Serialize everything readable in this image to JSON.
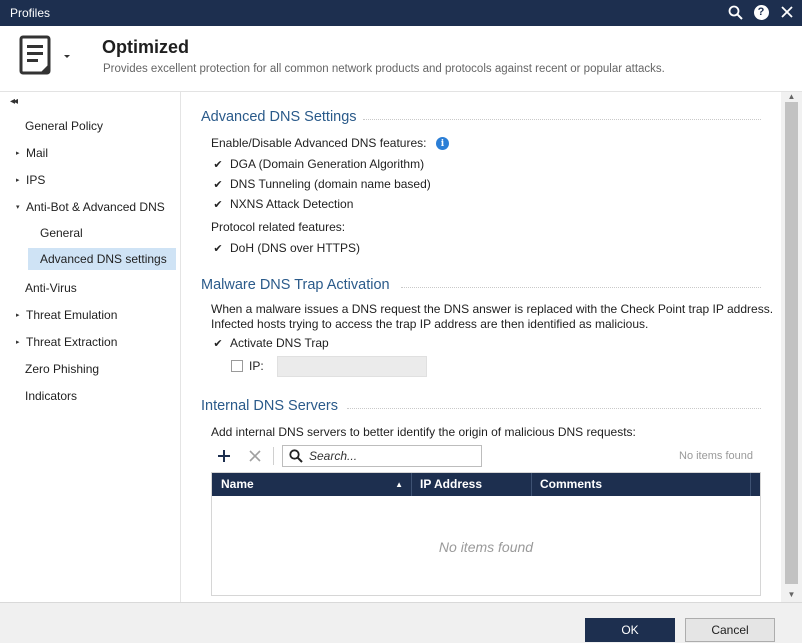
{
  "window": {
    "title": "Profiles"
  },
  "header": {
    "title": "Optimized",
    "description": "Provides excellent protection for all common network products and protocols against recent or popular attacks."
  },
  "sidebar": {
    "items": [
      {
        "label": "General Policy",
        "caret": ""
      },
      {
        "label": "Mail",
        "caret": "▸"
      },
      {
        "label": "IPS",
        "caret": "▸"
      },
      {
        "label": "Anti-Bot & Advanced DNS",
        "caret": "▾"
      },
      {
        "label": "General",
        "caret": ""
      },
      {
        "label": "Advanced DNS settings",
        "caret": ""
      },
      {
        "label": "Anti-Virus",
        "caret": ""
      },
      {
        "label": "Threat Emulation",
        "caret": "▸"
      },
      {
        "label": "Threat Extraction",
        "caret": "▸"
      },
      {
        "label": "Zero Phishing",
        "caret": ""
      },
      {
        "label": "Indicators",
        "caret": ""
      }
    ]
  },
  "advanced_dns": {
    "title": "Advanced DNS Settings",
    "enable_label": "Enable/Disable Advanced DNS features:",
    "options": [
      {
        "label": "DGA (Domain Generation Algorithm)",
        "checked": true
      },
      {
        "label": "DNS Tunneling (domain name based)",
        "checked": true
      },
      {
        "label": "NXNS Attack Detection",
        "checked": true
      }
    ],
    "protocol_label": "Protocol related features:",
    "protocol_options": [
      {
        "label": "DoH (DNS over HTTPS)",
        "checked": true
      }
    ]
  },
  "malware_trap": {
    "title": "Malware DNS Trap Activation",
    "description_line1": "When a malware issues a DNS request the DNS answer is replaced with the Check Point trap IP address.",
    "description_line2": "Infected hosts trying to access the trap IP address are then identified as malicious.",
    "activate_label": "Activate DNS Trap",
    "activate_checked": true,
    "ip_label": "IP:",
    "ip_checked": false,
    "ip_value": ""
  },
  "internal_dns": {
    "title": "Internal DNS Servers",
    "description": "Add internal DNS servers to better identify the origin of malicious DNS requests:",
    "search_placeholder": "Search...",
    "no_items_label": "No items found",
    "columns": [
      "Name",
      "IP Address",
      "Comments"
    ],
    "rows": [],
    "empty_text": "No items found"
  },
  "footer": {
    "ok_label": "OK",
    "cancel_label": "Cancel"
  },
  "colors": {
    "titlebar": "#1d2f4f",
    "section_title": "#2a5a8a",
    "selected_nav": "#cfe3f5",
    "info_icon": "#2b7ed6"
  }
}
